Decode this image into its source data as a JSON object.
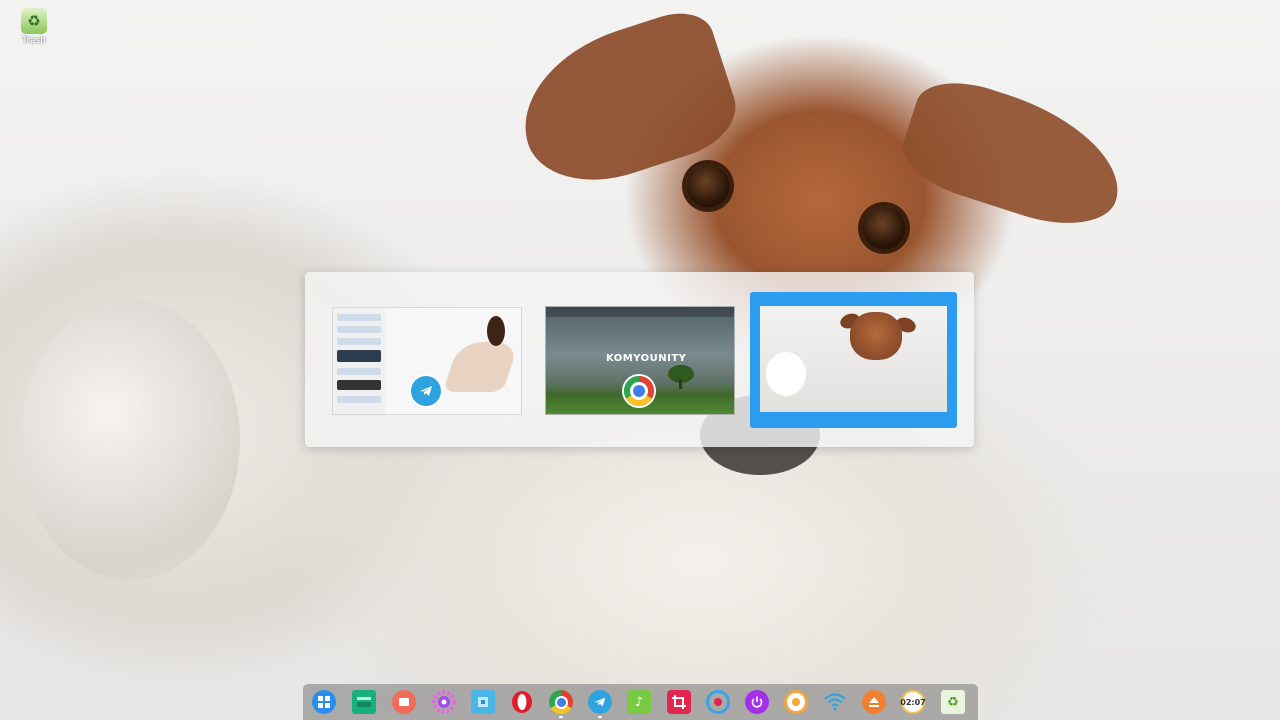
{
  "desktop": {
    "icons": [
      {
        "label": "Trash",
        "icon": "trash-icon"
      }
    ]
  },
  "switcher": {
    "windows": [
      {
        "app": "Telegram",
        "icon": "telegram-icon",
        "selected": false
      },
      {
        "app": "Chrome",
        "icon": "chrome-icon",
        "selected": false,
        "preview_title": "KOMYOUNITY"
      },
      {
        "app": "Desktop",
        "icon": "wallpaper-preview",
        "selected": true
      }
    ],
    "selected_color": "#2c9cf0"
  },
  "dock": {
    "items": [
      {
        "name": "launcher",
        "icon": "launcher-icon",
        "color": "#2a8ef0"
      },
      {
        "name": "multitasking",
        "icon": "multitasking-icon",
        "color": "#17b07a"
      },
      {
        "name": "screen-recorder",
        "icon": "screen-recorder-icon",
        "color": "#f06b5a"
      },
      {
        "name": "settings",
        "icon": "gear-icon",
        "color": "#a24cf0"
      },
      {
        "name": "file-manager",
        "icon": "folder-icon",
        "color": "#4ab6e8"
      },
      {
        "name": "opera",
        "icon": "opera-icon",
        "color": "#e21b2a"
      },
      {
        "name": "chrome",
        "icon": "chrome-icon",
        "color": "#f7c223"
      },
      {
        "name": "telegram",
        "icon": "telegram-icon",
        "color": "#2fa3e0"
      },
      {
        "name": "music",
        "icon": "music-icon",
        "color": "#7ac943"
      },
      {
        "name": "screenshot",
        "icon": "crop-icon",
        "color": "#e2264d"
      },
      {
        "name": "remote-assistance",
        "icon": "camera-icon",
        "color": "#3aa2e8"
      },
      {
        "name": "shutdown",
        "icon": "power-icon",
        "color": "#a230e8"
      },
      {
        "name": "clock-app",
        "icon": "clock-icon",
        "color": "#f4a53b"
      },
      {
        "name": "wifi",
        "icon": "wifi-icon",
        "color": "#2fa3e0"
      },
      {
        "name": "eject",
        "icon": "eject-icon",
        "color": "#f08030"
      },
      {
        "name": "datetime",
        "icon": "datetime-icon",
        "color": "#f6c44a",
        "text": "02:07"
      },
      {
        "name": "trash",
        "icon": "trash-icon",
        "color": "#8cc65a"
      }
    ]
  }
}
